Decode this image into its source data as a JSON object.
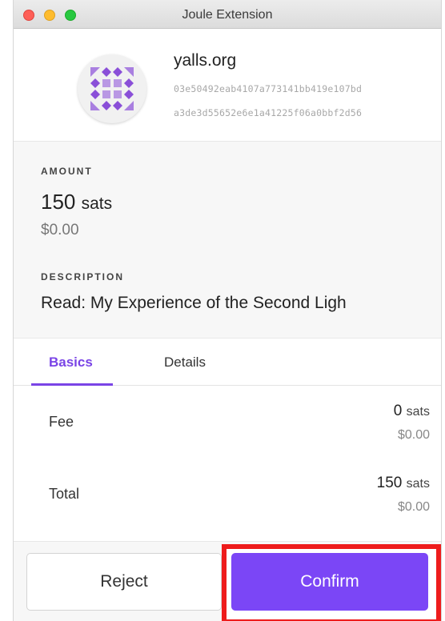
{
  "window": {
    "title": "Joule Extension"
  },
  "header": {
    "domain": "yalls.org",
    "pubkey_line1": "03e50492eab4107a773141bb419e107bd",
    "pubkey_line2": "a3de3d55652e6e1a41225f06a0bbf2d56",
    "avatar_icon": "identicon-avatar"
  },
  "payment": {
    "amount_label": "AMOUNT",
    "amount_value": "150",
    "amount_unit": "sats",
    "amount_fiat": "$0.00",
    "description_label": "DESCRIPTION",
    "description_value": "Read: My Experience of the Second Ligh"
  },
  "tabs": [
    {
      "label": "Basics",
      "active": true
    },
    {
      "label": "Details",
      "active": false
    }
  ],
  "basics": {
    "fee_label": "Fee",
    "fee_value": "0",
    "fee_unit": "sats",
    "fee_fiat": "$0.00",
    "total_label": "Total",
    "total_value": "150",
    "total_unit": "sats",
    "total_fiat": "$0.00"
  },
  "footer": {
    "reject_label": "Reject",
    "confirm_label": "Confirm"
  },
  "colors": {
    "accent": "#7b46f6",
    "highlight": "#ee1c1c",
    "identicon": "#8a4fd8"
  }
}
